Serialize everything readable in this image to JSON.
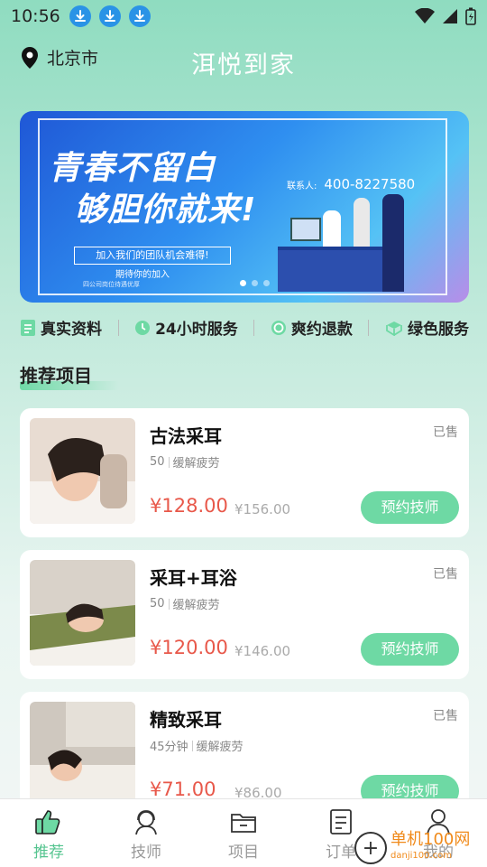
{
  "status": {
    "time": "10:56"
  },
  "header": {
    "city": "北京市",
    "title": "洱悦到家"
  },
  "banner": {
    "headline_1": "青春不留白",
    "headline_2": "够胆你就来!",
    "contact_label": "联系人:",
    "contact_number": "400-8227580",
    "join_text": "加入我们的团队机会难得!",
    "wait_text": "期待你的加入",
    "small_text": "四公司岗位待遇优厚",
    "page_count": 3,
    "active_page": 1
  },
  "features": [
    {
      "icon": "document-icon",
      "label": "真实资料"
    },
    {
      "icon": "clock-icon",
      "label": "24小时服务"
    },
    {
      "icon": "refund-icon",
      "label": "爽约退款"
    },
    {
      "icon": "leaf-icon",
      "label": "绿色服务"
    }
  ],
  "section": {
    "title": "推荐项目"
  },
  "products": [
    {
      "title": "古法采耳",
      "sold": "已售",
      "duration": "50",
      "benefit": "缓解疲劳",
      "price": "¥128.00",
      "original_price": "¥156.00",
      "button": "预约技师"
    },
    {
      "title": "采耳+耳浴",
      "sold": "已售",
      "duration": "50",
      "benefit": "缓解疲劳",
      "price": "¥120.00",
      "original_price": "¥146.00",
      "button": "预约技师"
    },
    {
      "title": "精致采耳",
      "sold": "已售",
      "duration": "45分钟",
      "benefit": "缓解疲劳",
      "price": "¥71.00",
      "original_price": "¥86.00",
      "button": "预约技师"
    }
  ],
  "tabbar": {
    "items": [
      {
        "label": "推荐",
        "icon": "thumbs-up-icon",
        "active": true
      },
      {
        "label": "技师",
        "icon": "technician-icon",
        "active": false
      },
      {
        "label": "项目",
        "icon": "folder-icon",
        "active": false
      },
      {
        "label": "订单",
        "icon": "order-icon",
        "active": false
      },
      {
        "label": "我的",
        "icon": "user-icon",
        "active": false
      }
    ]
  },
  "watermark": {
    "text": "单机100网",
    "url_text": "danji100.com"
  },
  "colors": {
    "accent": "#6ed9a4",
    "price": "#e8584a",
    "active_tab": "#55c48f"
  }
}
